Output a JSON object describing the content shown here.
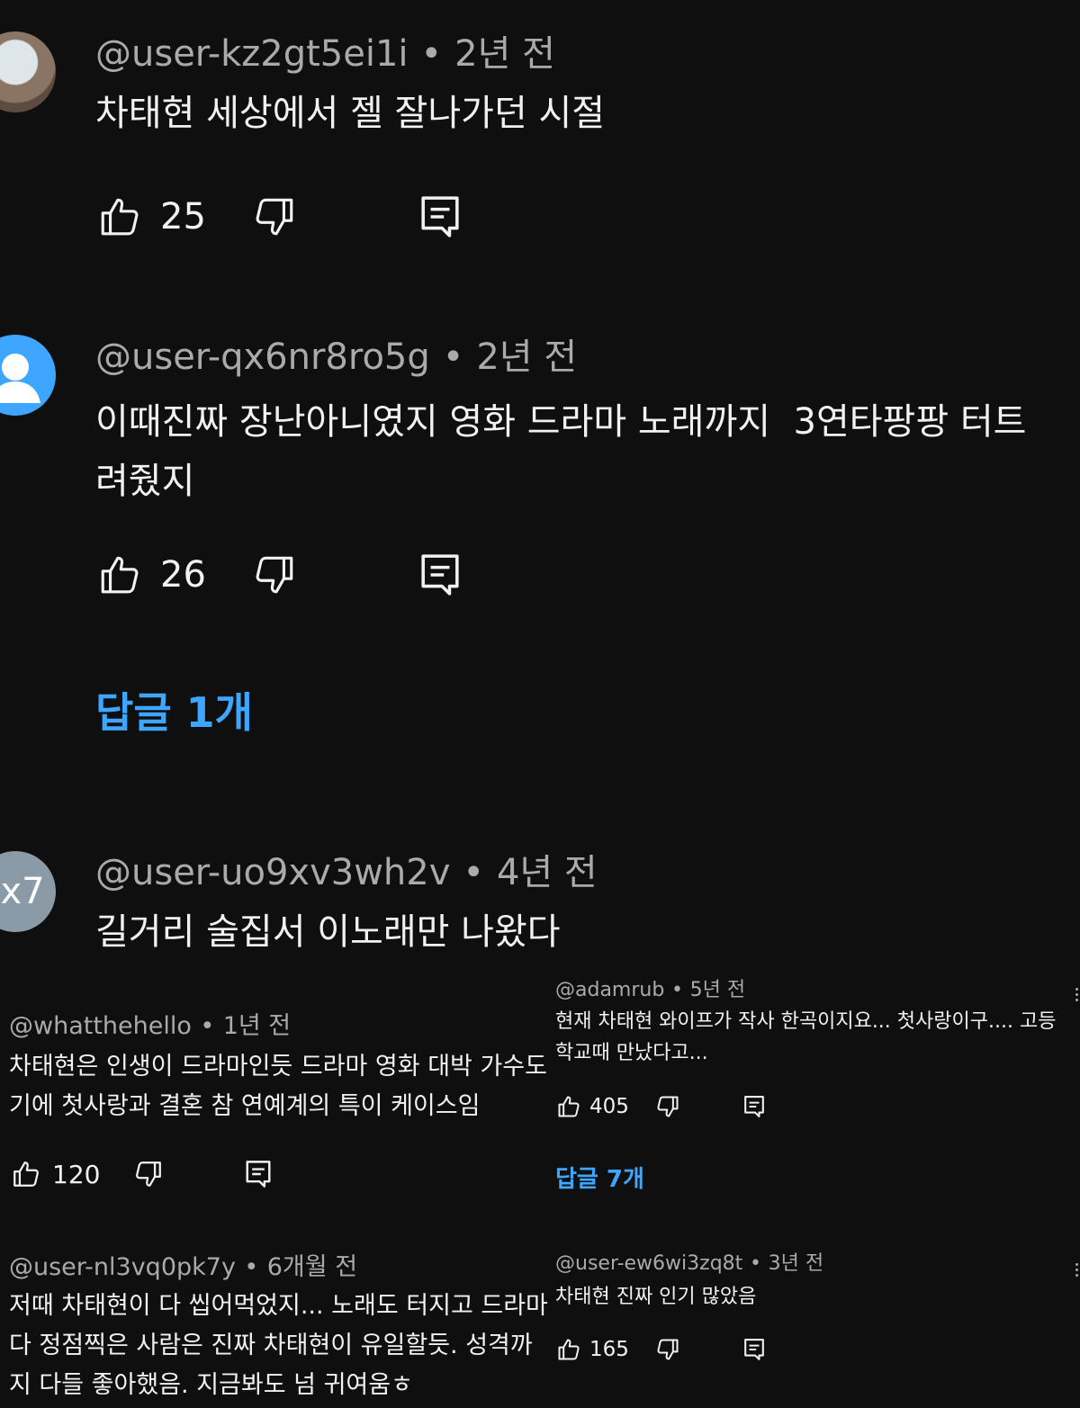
{
  "comments_large": [
    {
      "author": "@user-kz2gt5ei1i",
      "time": "2년 전",
      "text": "차태현 세상에서 젤 잘나가던 시절",
      "likes": "25"
    },
    {
      "author": "@user-qx6nr8ro5g",
      "time": "2년 전",
      "text": "이때진짜 장난아니였지 영화 드라마 노래까지  3연타팡팡 터트려줬지",
      "likes": "26",
      "replies": "답글 1개"
    },
    {
      "author": "@user-uo9xv3wh2v",
      "time": "4년 전",
      "text": "길거리 술집서 이노래만 나왔다",
      "avatar_text": "x7"
    }
  ],
  "comments_small_left": [
    {
      "author": "@whatthehello",
      "time": "1년 전",
      "text": "차태현은 인생이 드라마인듯 드라마 영화 대박 가수도 기에 첫사랑과 결혼 참 연예계의 특이 케이스임",
      "likes": "120"
    },
    {
      "author": "@user-nl3vq0pk7y",
      "time": "6개월 전",
      "text": "저때 차태현이 다 씹어먹었지... 노래도 터지고 드라마 다 정점찍은 사람은 진짜 차태현이 유일할듯. 성격까지 다들 좋아했음. 지금봐도 넘 귀여움ㅎ"
    }
  ],
  "comments_small_right": [
    {
      "author": "@adamrub",
      "time": "5년 전",
      "text": "현재 차태현 와이프가 작사 한곡이지요... 첫사랑이구.... 고등학교때 만났다고...",
      "likes": "405",
      "replies": "답글 7개"
    },
    {
      "author": "@user-ew6wi3zq8t",
      "time": "3년 전",
      "text": "차태현 진짜 인기 많았음",
      "likes": "165"
    }
  ],
  "separator": "•",
  "icons": {
    "like": "thumbs-up-icon",
    "dislike": "thumbs-down-icon",
    "reply": "reply-comment-icon",
    "more": "more-vert-icon",
    "default_avatar": "person-icon"
  },
  "colors": {
    "background": "#0f0f0f",
    "text": "#f1f1f1",
    "meta": "#aaaaaa",
    "link": "#3ea6ff",
    "avatar_blue": "#3ea6ff",
    "avatar_gray": "#8a9aa6"
  }
}
